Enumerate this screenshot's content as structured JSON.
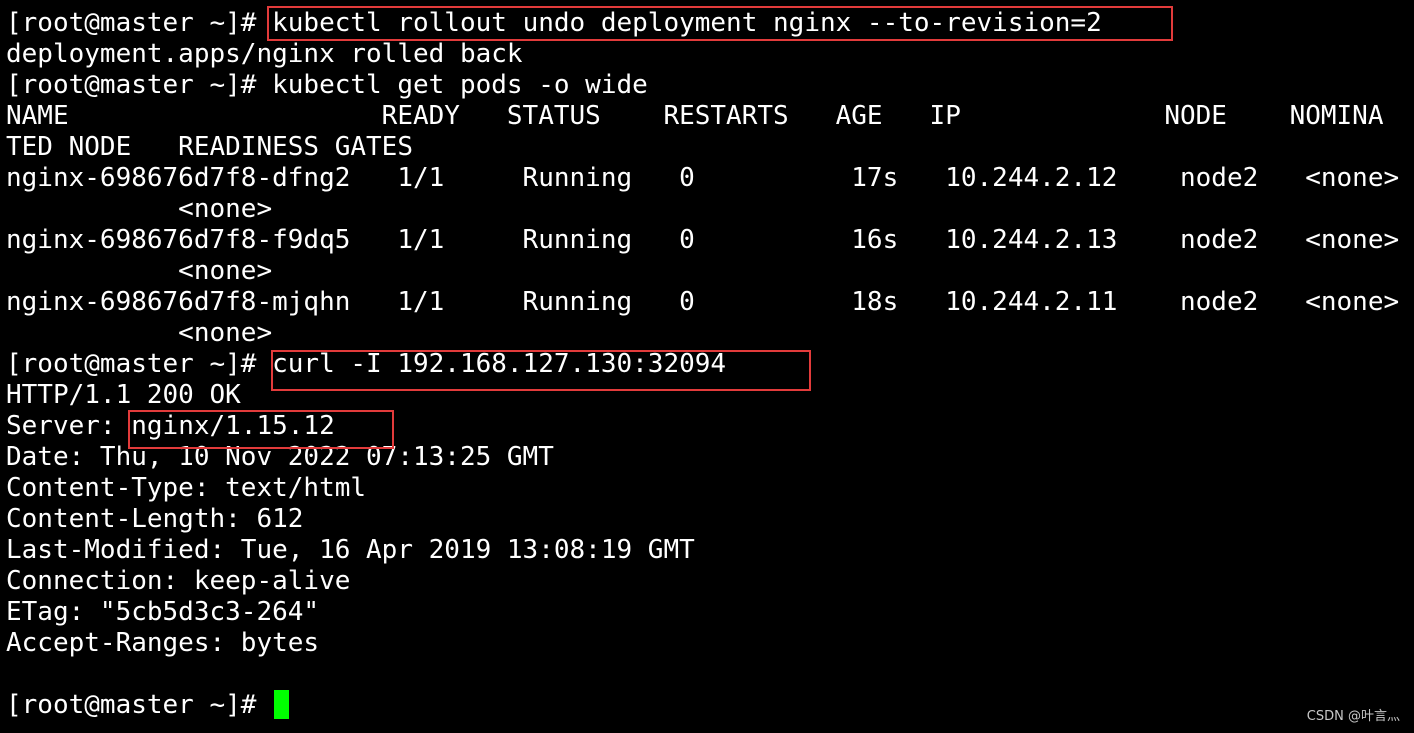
{
  "terminal": {
    "prompt": "[root@master ~]# ",
    "cursor_color": "#00ff00",
    "highlight_color": "#e23b3b",
    "lines": [
      {
        "prefix": "[root@master ~]# ",
        "text": "kubectl rollout undo deployment nginx --to-revision=2"
      },
      {
        "prefix": "",
        "text": "deployment.apps/nginx rolled back"
      },
      {
        "prefix": "[root@master ~]# ",
        "text": "kubectl get pods -o wide"
      },
      {
        "prefix": "",
        "text": "NAME                    READY   STATUS    RESTARTS   AGE   IP             NODE    NOMINA"
      },
      {
        "prefix": "",
        "text": "TED NODE   READINESS GATES"
      },
      {
        "prefix": "",
        "text": "nginx-698676d7f8-dfng2   1/1     Running   0          17s   10.244.2.12    node2   <none>"
      },
      {
        "prefix": "",
        "text": "           <none>"
      },
      {
        "prefix": "",
        "text": "nginx-698676d7f8-f9dq5   1/1     Running   0          16s   10.244.2.13    node2   <none>"
      },
      {
        "prefix": "",
        "text": "           <none>"
      },
      {
        "prefix": "",
        "text": "nginx-698676d7f8-mjqhn   1/1     Running   0          18s   10.244.2.11    node2   <none>"
      },
      {
        "prefix": "",
        "text": "           <none>"
      },
      {
        "prefix": "[root@master ~]# ",
        "text": "curl -I 192.168.127.130:32094"
      },
      {
        "prefix": "",
        "text": "HTTP/1.1 200 OK"
      },
      {
        "prefix": "Server: ",
        "text": "nginx/1.15.12"
      },
      {
        "prefix": "",
        "text": "Date: Thu, 10 Nov 2022 07:13:25 GMT"
      },
      {
        "prefix": "",
        "text": "Content-Type: text/html"
      },
      {
        "prefix": "",
        "text": "Content-Length: 612"
      },
      {
        "prefix": "",
        "text": "Last-Modified: Tue, 16 Apr 2019 13:08:19 GMT"
      },
      {
        "prefix": "",
        "text": "Connection: keep-alive"
      },
      {
        "prefix": "",
        "text": "ETag: \"5cb5d3c3-264\""
      },
      {
        "prefix": "",
        "text": "Accept-Ranges: bytes"
      },
      {
        "prefix": "",
        "text": ""
      }
    ]
  },
  "watermark": "CSDN @叶言灬"
}
